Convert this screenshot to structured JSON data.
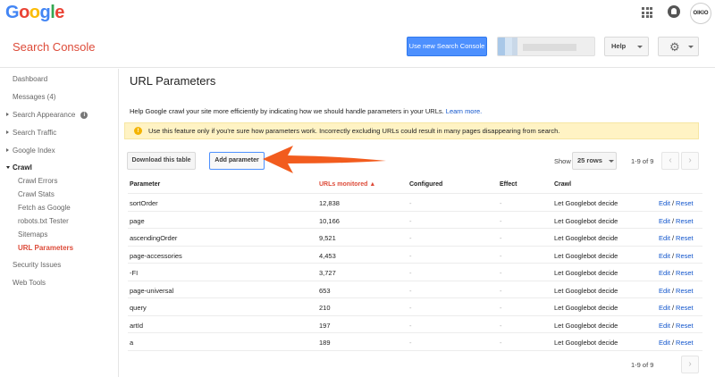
{
  "logo": [
    "G",
    "o",
    "o",
    "g",
    "l",
    "e"
  ],
  "user": {
    "avatar_text": "OIKIO"
  },
  "header": {
    "product_title": "Search Console",
    "new_sc_button": "Use new Search Console",
    "help_button": "Help"
  },
  "sidebar": {
    "items": [
      {
        "label": "Dashboard"
      },
      {
        "label": "Messages (4)"
      },
      {
        "label": "Search Appearance"
      },
      {
        "label": "Search Traffic"
      },
      {
        "label": "Google Index"
      },
      {
        "label": "Crawl"
      },
      {
        "label": "Crawl Errors"
      },
      {
        "label": "Crawl Stats"
      },
      {
        "label": "Fetch as Google"
      },
      {
        "label": "robots.txt Tester"
      },
      {
        "label": "Sitemaps"
      },
      {
        "label": "URL Parameters"
      },
      {
        "label": "Security Issues"
      },
      {
        "label": "Web Tools"
      }
    ]
  },
  "main": {
    "title": "URL Parameters",
    "description": "Help Google crawl your site more efficiently by indicating how we should handle parameters in your URLs.",
    "learn_more": "Learn more.",
    "warning": "Use this feature only if you're sure how parameters work. Incorrectly excluding URLs could result in many pages disappearing from search.",
    "download_button": "Download this table",
    "add_button": "Add parameter",
    "show_label": "Show",
    "rows_option": "25 rows",
    "pager_top": "1-9 of 9",
    "pager_bottom": "1-9 of 9"
  },
  "table": {
    "headers": [
      "Parameter",
      "URLs monitored",
      "Configured",
      "Effect",
      "Crawl"
    ],
    "sort_indicator": "▲",
    "rows": [
      {
        "parameter": "sortOrder",
        "urls": "12,838",
        "configured": "-",
        "effect": "-",
        "crawl": "Let Googlebot decide",
        "edit": "Edit",
        "sep": "/",
        "reset": "Reset"
      },
      {
        "parameter": "page",
        "urls": "10,166",
        "configured": "-",
        "effect": "-",
        "crawl": "Let Googlebot decide",
        "edit": "Edit",
        "sep": "/",
        "reset": "Reset"
      },
      {
        "parameter": "ascendingOrder",
        "urls": "9,521",
        "configured": "-",
        "effect": "-",
        "crawl": "Let Googlebot decide",
        "edit": "Edit",
        "sep": "/",
        "reset": "Reset"
      },
      {
        "parameter": "page-accessories",
        "urls": "4,453",
        "configured": "-",
        "effect": "-",
        "crawl": "Let Googlebot decide",
        "edit": "Edit",
        "sep": "/",
        "reset": "Reset"
      },
      {
        "parameter": "-FI",
        "urls": "3,727",
        "configured": "-",
        "effect": "-",
        "crawl": "Let Googlebot decide",
        "edit": "Edit",
        "sep": "/",
        "reset": "Reset"
      },
      {
        "parameter": "page-universal",
        "urls": "653",
        "configured": "-",
        "effect": "-",
        "crawl": "Let Googlebot decide",
        "edit": "Edit",
        "sep": "/",
        "reset": "Reset"
      },
      {
        "parameter": "query",
        "urls": "210",
        "configured": "-",
        "effect": "-",
        "crawl": "Let Googlebot decide",
        "edit": "Edit",
        "sep": "/",
        "reset": "Reset"
      },
      {
        "parameter": "artId",
        "urls": "197",
        "configured": "-",
        "effect": "-",
        "crawl": "Let Googlebot decide",
        "edit": "Edit",
        "sep": "/",
        "reset": "Reset"
      },
      {
        "parameter": "a",
        "urls": "189",
        "configured": "-",
        "effect": "-",
        "crawl": "Let Googlebot decide",
        "edit": "Edit",
        "sep": "/",
        "reset": "Reset"
      }
    ]
  },
  "colors": {
    "brand_red": "#dd4b39",
    "primary_blue": "#4d90fe",
    "link_blue": "#1155cc",
    "warning_bg": "#fff3c4",
    "arrow_orange": "#f25c1e"
  },
  "icons": [
    "apps-icon",
    "notifications-icon",
    "gear-icon",
    "info-icon",
    "warning-icon",
    "chevron-left-icon",
    "chevron-right-icon",
    "annotation-arrow"
  ]
}
